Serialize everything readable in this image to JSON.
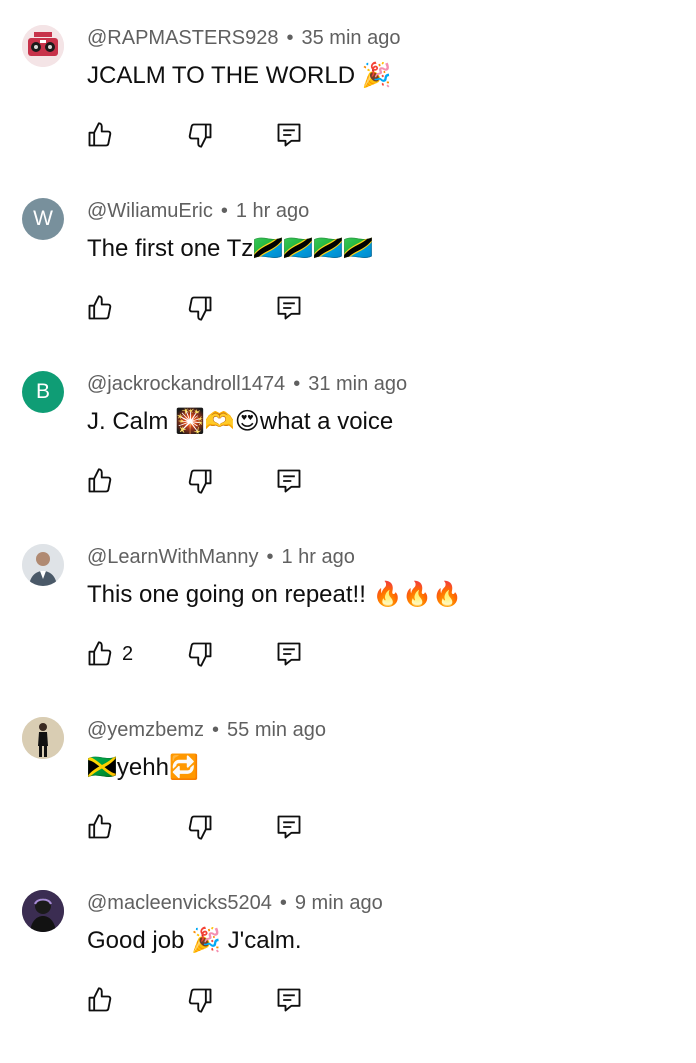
{
  "comments": [
    {
      "author": "@RAPMASTERS928",
      "time": "35 min ago",
      "text": "JCALM TO THE WORLD",
      "emoji_suffix": "🎉",
      "avatar_type": "image",
      "avatar_color": "#c7324a",
      "likes": ""
    },
    {
      "author": "@WiliamuEric",
      "time": "1 hr ago",
      "text": "The first one Tz",
      "emoji_suffix": "🇹🇿🇹🇿🇹🇿🇹🇿",
      "avatar_type": "letter",
      "avatar_letter": "W",
      "avatar_color": "#78909c",
      "likes": ""
    },
    {
      "author": "@jackrockandroll1474",
      "time": "31 min ago",
      "text": "J. Calm",
      "emoji_suffix": "🎇🫶😍",
      "text_after": "what a voice",
      "avatar_type": "letter",
      "avatar_letter": "B",
      "avatar_color": "#0f9d75",
      "likes": ""
    },
    {
      "author": "@LearnWithManny",
      "time": "1 hr ago",
      "text": "This one going on repeat!!",
      "emoji_suffix": "🔥🔥🔥",
      "avatar_type": "image",
      "avatar_color": "#7b8896",
      "likes": "2"
    },
    {
      "author": "@yemzbemz",
      "time": "55 min ago",
      "text": "yehh",
      "emoji_prefix": "🇯🇲",
      "emoji_suffix": "🔁",
      "avatar_type": "image",
      "avatar_color": "#c9b99a",
      "likes": ""
    },
    {
      "author": "@macleenvicks5204",
      "time": "9 min ago",
      "text": "Good job",
      "emoji_suffix": "🎉",
      "text_after": "J'calm.",
      "avatar_type": "image",
      "avatar_color": "#2a1f3a",
      "likes": ""
    }
  ],
  "icons": {
    "like": "thumbs-up-icon",
    "dislike": "thumbs-down-icon",
    "reply": "reply-icon"
  }
}
